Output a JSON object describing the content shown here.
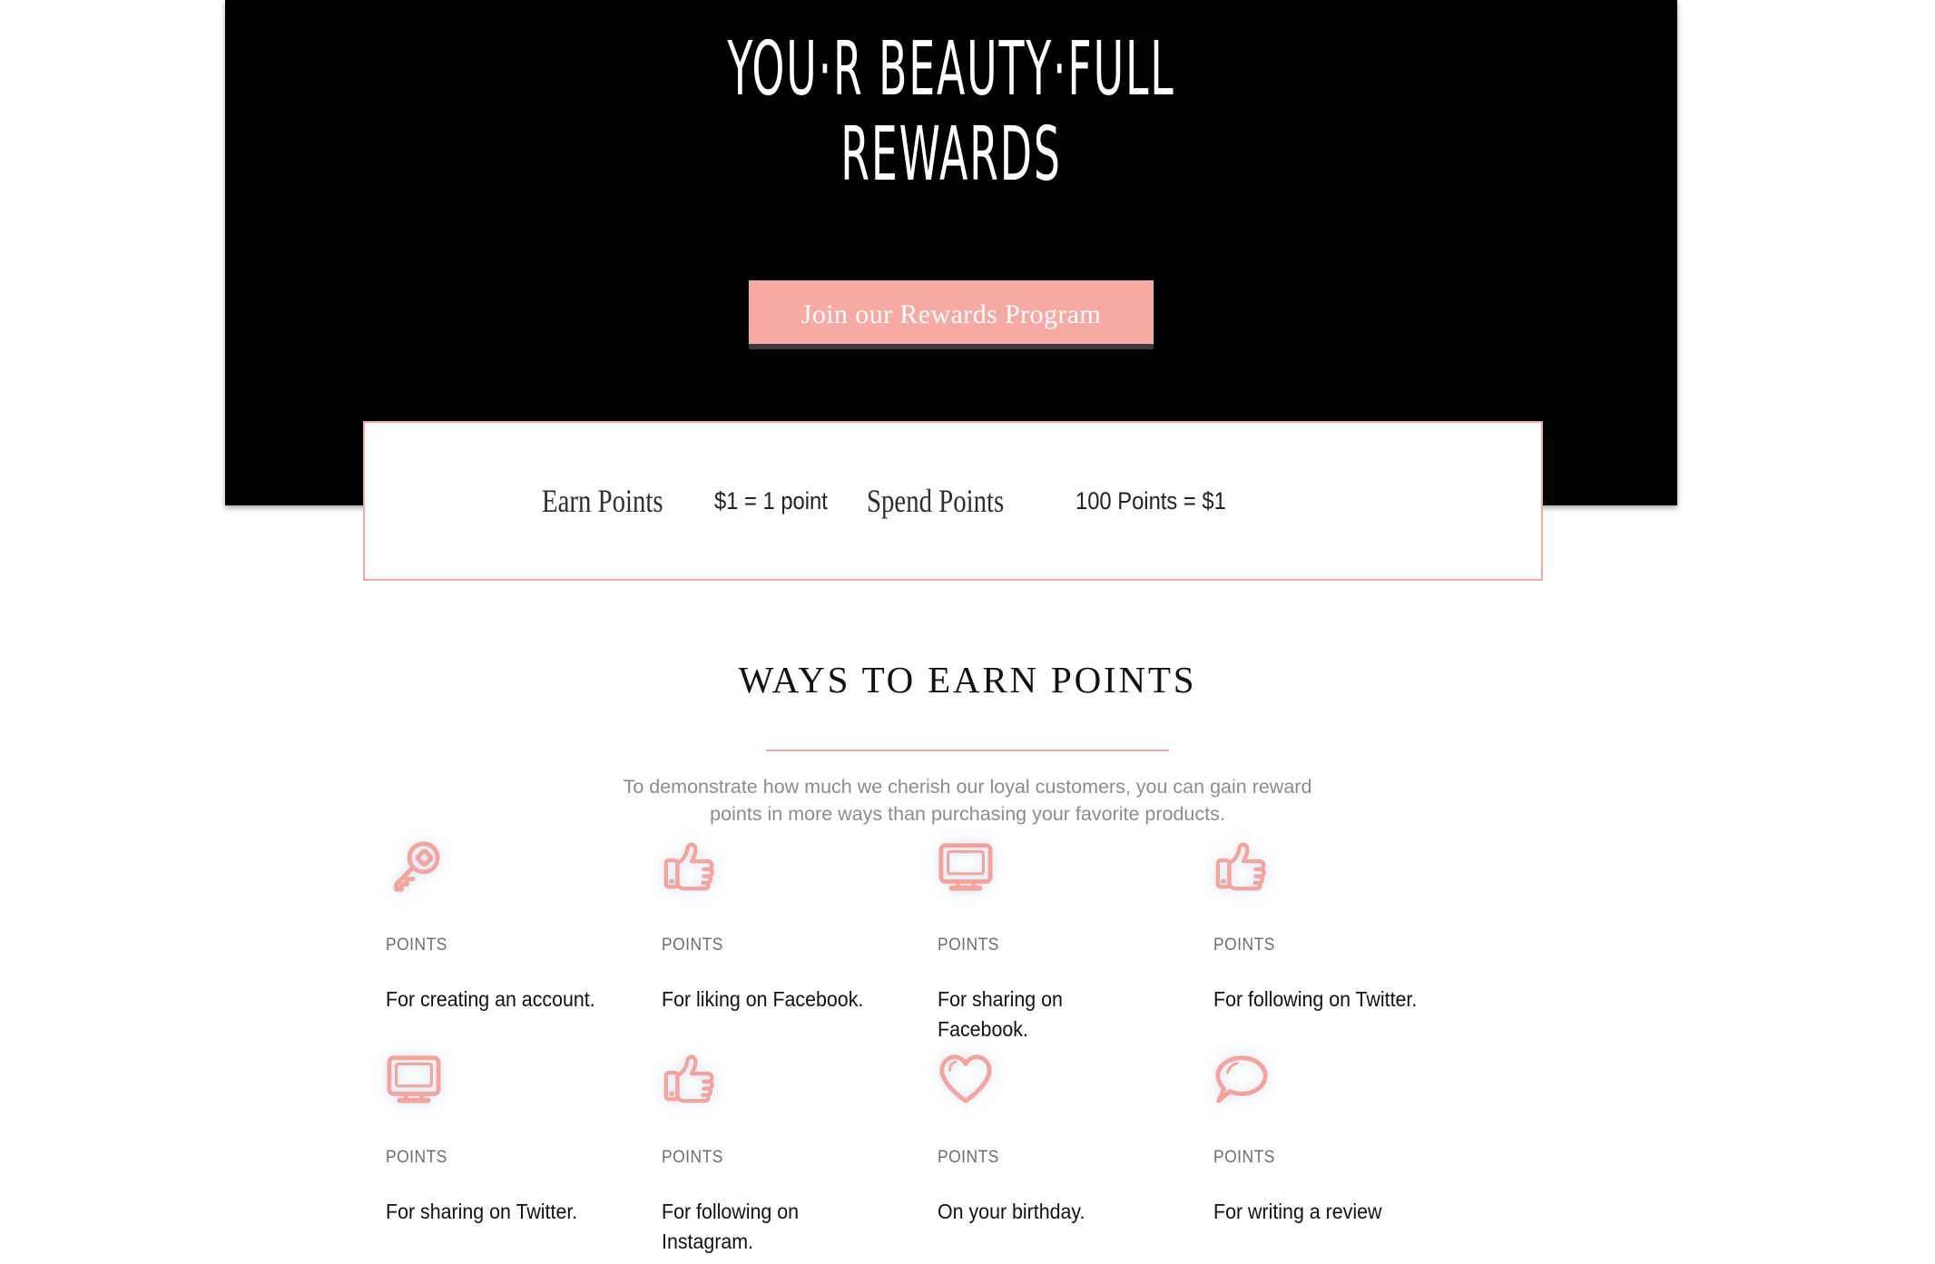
{
  "hero": {
    "title": "YOU·R BEAUTY·FULL\nREWARDS",
    "cta_label": "Join our Rewards Program",
    "background_color": "#000000",
    "cta_color": "#F7AAA4"
  },
  "rate_bar": {
    "earn_term": "Earn Points",
    "earn_value": "$1 = 1 point",
    "spend_term": "Spend Points",
    "spend_value": "100 Points = $1",
    "border_color": "#F3A9A2"
  },
  "ways": {
    "heading": "WAYS TO EARN POINTS",
    "divider_color": "#F3A9A2",
    "intro": "To demonstrate how much we cherish our loyal customers, you can gain reward\npoints in more ways than purchasing your favorite products.",
    "points_label": "POINTS",
    "icon_color": "#F3A9A2",
    "items": [
      {
        "icon": "key-icon",
        "points": "POINTS",
        "description": "For creating an account."
      },
      {
        "icon": "thumbs-up-icon",
        "points": "POINTS",
        "description": "For liking on Facebook."
      },
      {
        "icon": "monitor-icon",
        "points": "POINTS",
        "description": "For sharing on Facebook."
      },
      {
        "icon": "thumbs-up-icon",
        "points": "POINTS",
        "description": "For following on Twitter."
      },
      {
        "icon": "monitor-icon",
        "points": "POINTS",
        "description": "For sharing on Twitter."
      },
      {
        "icon": "thumbs-up-icon",
        "points": "POINTS",
        "description": "For following on Instagram."
      },
      {
        "icon": "heart-icon",
        "points": "POINTS",
        "description": "On your birthday."
      },
      {
        "icon": "speech-bubble-icon",
        "points": "POINTS",
        "description": "For writing a review"
      }
    ]
  }
}
